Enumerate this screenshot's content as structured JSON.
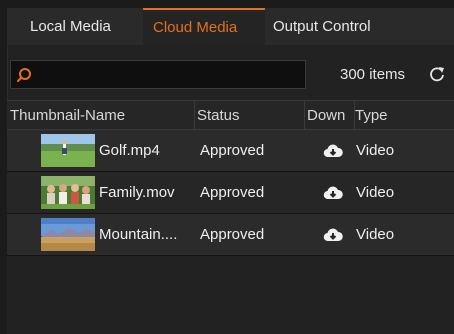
{
  "tabs": [
    {
      "label": "Local Media"
    },
    {
      "label": "Cloud Media"
    },
    {
      "label": "Output Control"
    }
  ],
  "search": {
    "placeholder": "",
    "value": ""
  },
  "items_count": "300 items",
  "columns": [
    "Thumbnail-Name",
    "Status",
    "Down",
    "Type"
  ],
  "rows": [
    {
      "name": "Golf.mp4",
      "status": "Approved",
      "type": "Video"
    },
    {
      "name": "Family.mov",
      "status": "Approved",
      "type": "Video"
    },
    {
      "name": "Mountain....",
      "status": "Approved",
      "type": "Video"
    }
  ],
  "colors": {
    "accent": "#e2701f",
    "background": "#222222"
  },
  "icons": {
    "search": "search-icon",
    "refresh": "refresh-icon",
    "download": "cloud-download-icon"
  }
}
